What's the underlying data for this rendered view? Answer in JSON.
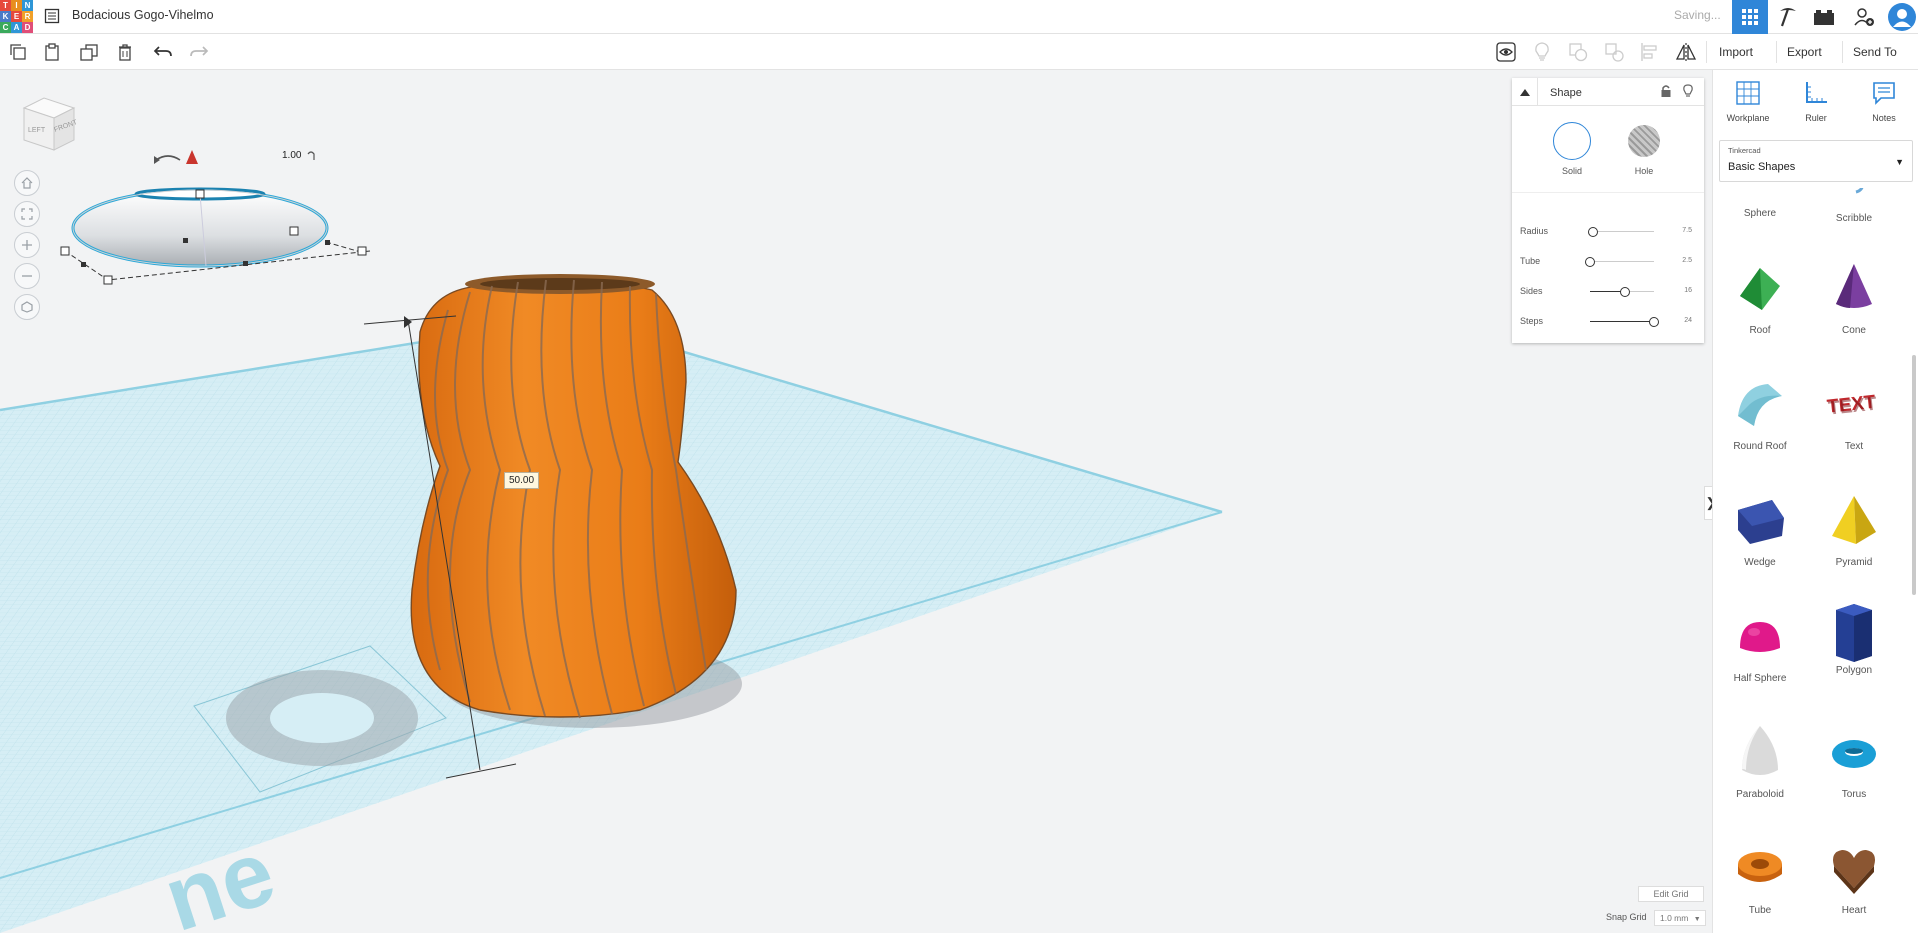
{
  "app": {
    "logo_letters": [
      "T",
      "I",
      "N",
      "K",
      "E",
      "R",
      "C",
      "A",
      "D"
    ],
    "logo_colors": [
      "#e64a3c",
      "#e88e1e",
      "#2f96d6",
      "#4a7ac7",
      "#e64a3c",
      "#f0a029",
      "#3aa95c",
      "#2f96d6",
      "#e04e78"
    ],
    "design_title": "Bodacious Gogo-Vihelmo",
    "saving_status": "Saving..."
  },
  "topbar_icons": [
    "grid-view-icon",
    "pickaxe-icon",
    "bricks-icon",
    "add-user-icon",
    "user-avatar"
  ],
  "toolbar": {
    "left_tools": [
      "copy-icon",
      "paste-icon",
      "duplicate-icon",
      "delete-icon",
      "undo-icon",
      "redo-icon"
    ],
    "right_tools": [
      "show-all-icon",
      "light-bulb-icon",
      "group-icon",
      "ungroup-icon",
      "align-icon",
      "mirror-icon"
    ],
    "import_label": "Import",
    "export_label": "Export",
    "send_to_label": "Send To"
  },
  "view_cube": {
    "left_label": "LEFT",
    "front_label": "FRONT"
  },
  "view_controls": [
    "home-icon",
    "fit-view-icon",
    "zoom-in-icon",
    "zoom-out-icon",
    "perspective-icon"
  ],
  "viewport": {
    "height_dimension": "50.00",
    "ring_rotation_value": "1.00",
    "workplane_watermark": "ne"
  },
  "shape_panel": {
    "title": "Shape",
    "solid_label": "Solid",
    "hole_label": "Hole",
    "params": [
      {
        "label": "Radius",
        "value": "7.5",
        "fraction": 0.05
      },
      {
        "label": "Tube",
        "value": "2.5",
        "fraction": 0.0
      },
      {
        "label": "Sides",
        "value": "16",
        "fraction": 0.55
      },
      {
        "label": "Steps",
        "value": "24",
        "fraction": 1.0
      }
    ]
  },
  "right_panel": {
    "tools": [
      {
        "label": "Workplane",
        "icon": "workplane-icon"
      },
      {
        "label": "Ruler",
        "icon": "ruler-icon"
      },
      {
        "label": "Notes",
        "icon": "notes-icon"
      }
    ],
    "library_caption": "Tinkercad",
    "library_value": "Basic Shapes",
    "shapes": [
      {
        "label": "Sphere",
        "color": "#9ea3a8"
      },
      {
        "label": "Scribble",
        "color": "#6aa9d8"
      },
      {
        "label": "Roof",
        "color": "#2f9e44"
      },
      {
        "label": "Cone",
        "color": "#7b3fa0"
      },
      {
        "label": "Round Roof",
        "color": "#7ec3d1"
      },
      {
        "label": "Text",
        "color": "#c0282d"
      },
      {
        "label": "Wedge",
        "color": "#24337a"
      },
      {
        "label": "Pyramid",
        "color": "#e8c51a"
      },
      {
        "label": "Half Sphere",
        "color": "#e0198a"
      },
      {
        "label": "Polygon",
        "color": "#1f3a8a"
      },
      {
        "label": "Paraboloid",
        "color": "#cfcfcf"
      },
      {
        "label": "Torus",
        "color": "#1a9fd6"
      },
      {
        "label": "Tube",
        "color": "#e07a1c"
      },
      {
        "label": "Heart",
        "color": "#7a4a2a"
      }
    ]
  },
  "footer": {
    "edit_grid_label": "Edit Grid",
    "snap_grid_label": "Snap Grid",
    "snap_grid_value": "1.0 mm"
  }
}
